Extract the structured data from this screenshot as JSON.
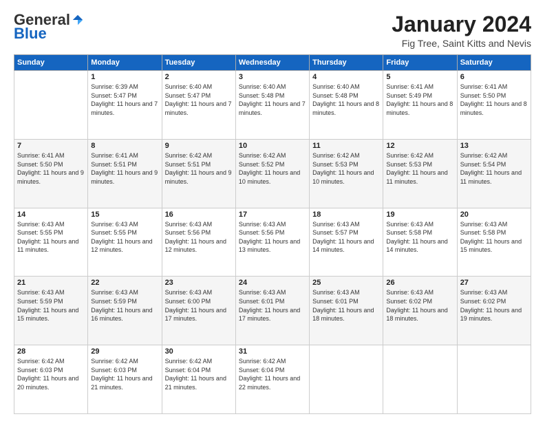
{
  "header": {
    "logo_general": "General",
    "logo_blue": "Blue",
    "month_title": "January 2024",
    "location": "Fig Tree, Saint Kitts and Nevis"
  },
  "days_of_week": [
    "Sunday",
    "Monday",
    "Tuesday",
    "Wednesday",
    "Thursday",
    "Friday",
    "Saturday"
  ],
  "weeks": [
    [
      {
        "day": "",
        "sunrise": "",
        "sunset": "",
        "daylight": ""
      },
      {
        "day": "1",
        "sunrise": "Sunrise: 6:39 AM",
        "sunset": "Sunset: 5:47 PM",
        "daylight": "Daylight: 11 hours and 7 minutes."
      },
      {
        "day": "2",
        "sunrise": "Sunrise: 6:40 AM",
        "sunset": "Sunset: 5:47 PM",
        "daylight": "Daylight: 11 hours and 7 minutes."
      },
      {
        "day": "3",
        "sunrise": "Sunrise: 6:40 AM",
        "sunset": "Sunset: 5:48 PM",
        "daylight": "Daylight: 11 hours and 7 minutes."
      },
      {
        "day": "4",
        "sunrise": "Sunrise: 6:40 AM",
        "sunset": "Sunset: 5:48 PM",
        "daylight": "Daylight: 11 hours and 8 minutes."
      },
      {
        "day": "5",
        "sunrise": "Sunrise: 6:41 AM",
        "sunset": "Sunset: 5:49 PM",
        "daylight": "Daylight: 11 hours and 8 minutes."
      },
      {
        "day": "6",
        "sunrise": "Sunrise: 6:41 AM",
        "sunset": "Sunset: 5:50 PM",
        "daylight": "Daylight: 11 hours and 8 minutes."
      }
    ],
    [
      {
        "day": "7",
        "sunrise": "Sunrise: 6:41 AM",
        "sunset": "Sunset: 5:50 PM",
        "daylight": "Daylight: 11 hours and 9 minutes."
      },
      {
        "day": "8",
        "sunrise": "Sunrise: 6:41 AM",
        "sunset": "Sunset: 5:51 PM",
        "daylight": "Daylight: 11 hours and 9 minutes."
      },
      {
        "day": "9",
        "sunrise": "Sunrise: 6:42 AM",
        "sunset": "Sunset: 5:51 PM",
        "daylight": "Daylight: 11 hours and 9 minutes."
      },
      {
        "day": "10",
        "sunrise": "Sunrise: 6:42 AM",
        "sunset": "Sunset: 5:52 PM",
        "daylight": "Daylight: 11 hours and 10 minutes."
      },
      {
        "day": "11",
        "sunrise": "Sunrise: 6:42 AM",
        "sunset": "Sunset: 5:53 PM",
        "daylight": "Daylight: 11 hours and 10 minutes."
      },
      {
        "day": "12",
        "sunrise": "Sunrise: 6:42 AM",
        "sunset": "Sunset: 5:53 PM",
        "daylight": "Daylight: 11 hours and 11 minutes."
      },
      {
        "day": "13",
        "sunrise": "Sunrise: 6:42 AM",
        "sunset": "Sunset: 5:54 PM",
        "daylight": "Daylight: 11 hours and 11 minutes."
      }
    ],
    [
      {
        "day": "14",
        "sunrise": "Sunrise: 6:43 AM",
        "sunset": "Sunset: 5:55 PM",
        "daylight": "Daylight: 11 hours and 11 minutes."
      },
      {
        "day": "15",
        "sunrise": "Sunrise: 6:43 AM",
        "sunset": "Sunset: 5:55 PM",
        "daylight": "Daylight: 11 hours and 12 minutes."
      },
      {
        "day": "16",
        "sunrise": "Sunrise: 6:43 AM",
        "sunset": "Sunset: 5:56 PM",
        "daylight": "Daylight: 11 hours and 12 minutes."
      },
      {
        "day": "17",
        "sunrise": "Sunrise: 6:43 AM",
        "sunset": "Sunset: 5:56 PM",
        "daylight": "Daylight: 11 hours and 13 minutes."
      },
      {
        "day": "18",
        "sunrise": "Sunrise: 6:43 AM",
        "sunset": "Sunset: 5:57 PM",
        "daylight": "Daylight: 11 hours and 14 minutes."
      },
      {
        "day": "19",
        "sunrise": "Sunrise: 6:43 AM",
        "sunset": "Sunset: 5:58 PM",
        "daylight": "Daylight: 11 hours and 14 minutes."
      },
      {
        "day": "20",
        "sunrise": "Sunrise: 6:43 AM",
        "sunset": "Sunset: 5:58 PM",
        "daylight": "Daylight: 11 hours and 15 minutes."
      }
    ],
    [
      {
        "day": "21",
        "sunrise": "Sunrise: 6:43 AM",
        "sunset": "Sunset: 5:59 PM",
        "daylight": "Daylight: 11 hours and 15 minutes."
      },
      {
        "day": "22",
        "sunrise": "Sunrise: 6:43 AM",
        "sunset": "Sunset: 5:59 PM",
        "daylight": "Daylight: 11 hours and 16 minutes."
      },
      {
        "day": "23",
        "sunrise": "Sunrise: 6:43 AM",
        "sunset": "Sunset: 6:00 PM",
        "daylight": "Daylight: 11 hours and 17 minutes."
      },
      {
        "day": "24",
        "sunrise": "Sunrise: 6:43 AM",
        "sunset": "Sunset: 6:01 PM",
        "daylight": "Daylight: 11 hours and 17 minutes."
      },
      {
        "day": "25",
        "sunrise": "Sunrise: 6:43 AM",
        "sunset": "Sunset: 6:01 PM",
        "daylight": "Daylight: 11 hours and 18 minutes."
      },
      {
        "day": "26",
        "sunrise": "Sunrise: 6:43 AM",
        "sunset": "Sunset: 6:02 PM",
        "daylight": "Daylight: 11 hours and 18 minutes."
      },
      {
        "day": "27",
        "sunrise": "Sunrise: 6:43 AM",
        "sunset": "Sunset: 6:02 PM",
        "daylight": "Daylight: 11 hours and 19 minutes."
      }
    ],
    [
      {
        "day": "28",
        "sunrise": "Sunrise: 6:42 AM",
        "sunset": "Sunset: 6:03 PM",
        "daylight": "Daylight: 11 hours and 20 minutes."
      },
      {
        "day": "29",
        "sunrise": "Sunrise: 6:42 AM",
        "sunset": "Sunset: 6:03 PM",
        "daylight": "Daylight: 11 hours and 21 minutes."
      },
      {
        "day": "30",
        "sunrise": "Sunrise: 6:42 AM",
        "sunset": "Sunset: 6:04 PM",
        "daylight": "Daylight: 11 hours and 21 minutes."
      },
      {
        "day": "31",
        "sunrise": "Sunrise: 6:42 AM",
        "sunset": "Sunset: 6:04 PM",
        "daylight": "Daylight: 11 hours and 22 minutes."
      },
      {
        "day": "",
        "sunrise": "",
        "sunset": "",
        "daylight": ""
      },
      {
        "day": "",
        "sunrise": "",
        "sunset": "",
        "daylight": ""
      },
      {
        "day": "",
        "sunrise": "",
        "sunset": "",
        "daylight": ""
      }
    ]
  ]
}
